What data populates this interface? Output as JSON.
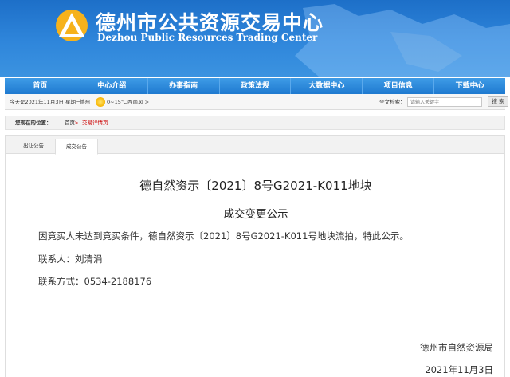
{
  "header": {
    "title_cn": "德州市公共资源交易中心",
    "title_en": "Dezhou Public Resources Trading Center",
    "logo_icon": "triangle-mountain-logo-icon",
    "brand_color": "#2a7fd4"
  },
  "nav": {
    "items": [
      {
        "label": "首页"
      },
      {
        "label": "中心介绍"
      },
      {
        "label": "办事指南"
      },
      {
        "label": "政策法规"
      },
      {
        "label": "大数据中心"
      },
      {
        "label": "项目信息"
      },
      {
        "label": "下载中心"
      }
    ]
  },
  "infobar": {
    "date": "今天是2021年11月3日  星期三",
    "city": "德州",
    "weather_icon": "sun-icon",
    "temperature": "0~15℃",
    "wind": "西南风 >",
    "search_label": "全文检索：",
    "search_placeholder": "请输入关键字",
    "search_button": "搜 索"
  },
  "breadcrumb": {
    "label": "您现在的位置：",
    "home": "首页",
    "separator": ">",
    "current": "交易详情页"
  },
  "tabs": [
    {
      "label": "出让公告"
    },
    {
      "label": "成交公告"
    }
  ],
  "document": {
    "title": "德自然资示〔2021〕8号G2021-K011地块",
    "subtitle": "成交变更公示",
    "paragraph": "因竞买人未达到竞买条件，德自然资示〔2021〕8号G2021-K011号地块流拍，特此公示。",
    "contact_person": "联系人：刘清涓",
    "contact_phone": "联系方式：0534-2188176",
    "signing_org": "德州市自然资源局",
    "signing_date": "2021年11月3日"
  }
}
